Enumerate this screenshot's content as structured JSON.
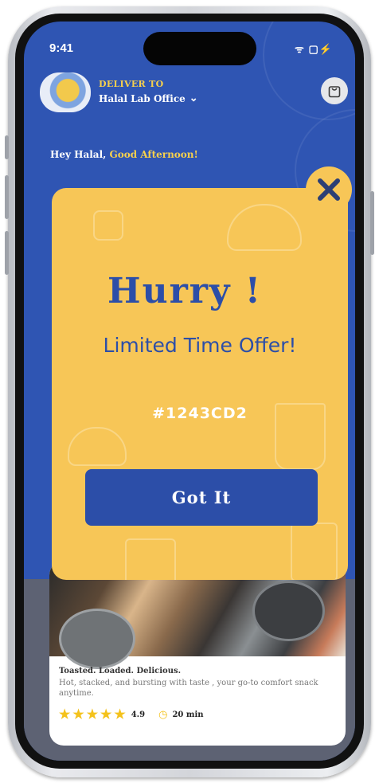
{
  "status_bar": {
    "time": "9:41",
    "icons": "ᯤ ▢⚡"
  },
  "header": {
    "deliver_label": "DELIVER TO",
    "location": "Halal Lab Office",
    "chevron": "⌄",
    "cart_icon": "bag-icon"
  },
  "greeting": {
    "name_part": "Hey Halal, ",
    "time_part": "Good Afternoon!"
  },
  "popup": {
    "title": "Hurry !",
    "subtitle": "Limited Time Offer!",
    "code": "#1243CD2",
    "button_label": "Got It",
    "close_icon": "close-icon"
  },
  "food_card": {
    "title": "Toasted. Loaded. Delicious.",
    "description": "Hot, stacked, and bursting with taste , your go-to comfort snack anytime.",
    "stars": 5,
    "rating": "4.9",
    "delivery_time": "20 min"
  },
  "colors": {
    "brand_blue": "#2f55b3",
    "accent_yellow": "#f7c657",
    "button_blue": "#2c4ea8"
  }
}
